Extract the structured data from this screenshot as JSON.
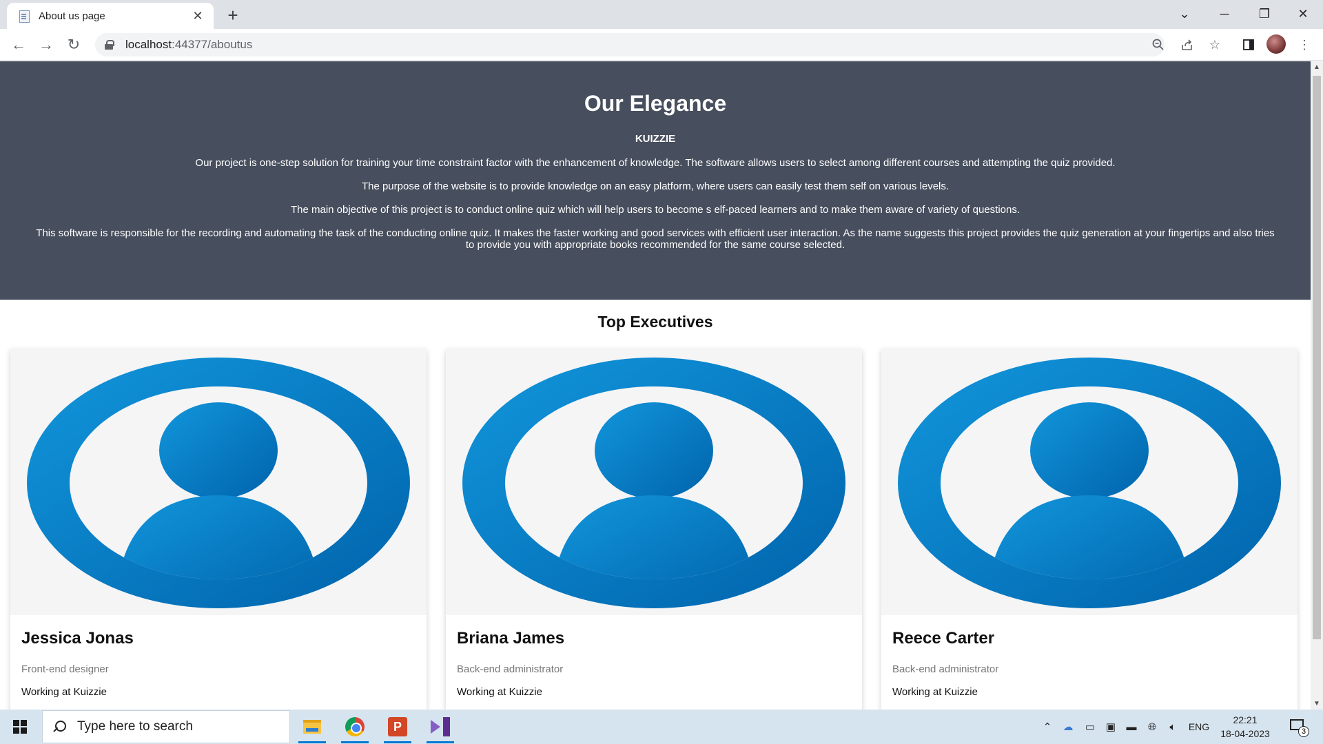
{
  "browser": {
    "tab_title": "About us page",
    "new_tab": "+",
    "url_host": "localhost",
    "url_path": ":44377/aboutus"
  },
  "page": {
    "hero_title": "Our Elegance",
    "brand": "KUIZZIE",
    "paragraphs": [
      "Our project is one-step solution for training your time constraint factor with the enhancement of knowledge. The software allows users to select among different courses and attempting the quiz provided.",
      "The purpose of the website is to provide knowledge on an easy platform, where users can easily test them self on various levels.",
      "The main objective of this project is to conduct online quiz which will help users to become s elf-paced learners and to make them aware of variety of questions.",
      "This software is responsible for the recording and automating the task of the conducting online quiz. It makes the faster working and good services with efficient user interaction. As the name suggests this project provides the quiz generation at your fingertips and also tries to provide you with appropriate books recommended for the same course selected."
    ],
    "section_title": "Top Executives",
    "executives": [
      {
        "name": "Jessica Jonas",
        "role": "Front-end designer",
        "work": "Working at Kuizzie"
      },
      {
        "name": "Briana James",
        "role": "Back-end administrator",
        "work": "Working at Kuizzie"
      },
      {
        "name": "Reece Carter",
        "role": "Back-end administrator",
        "work": "Working at Kuizzie"
      }
    ]
  },
  "taskbar": {
    "search_placeholder": "Type here to search",
    "language": "ENG",
    "time": "22:21",
    "date": "18-04-2023",
    "notification_count": "3"
  },
  "colors": {
    "hero_bg": "#474e5d",
    "avatar_blue": "#0a74c4",
    "taskbar_bg": "#d6e4ef"
  }
}
